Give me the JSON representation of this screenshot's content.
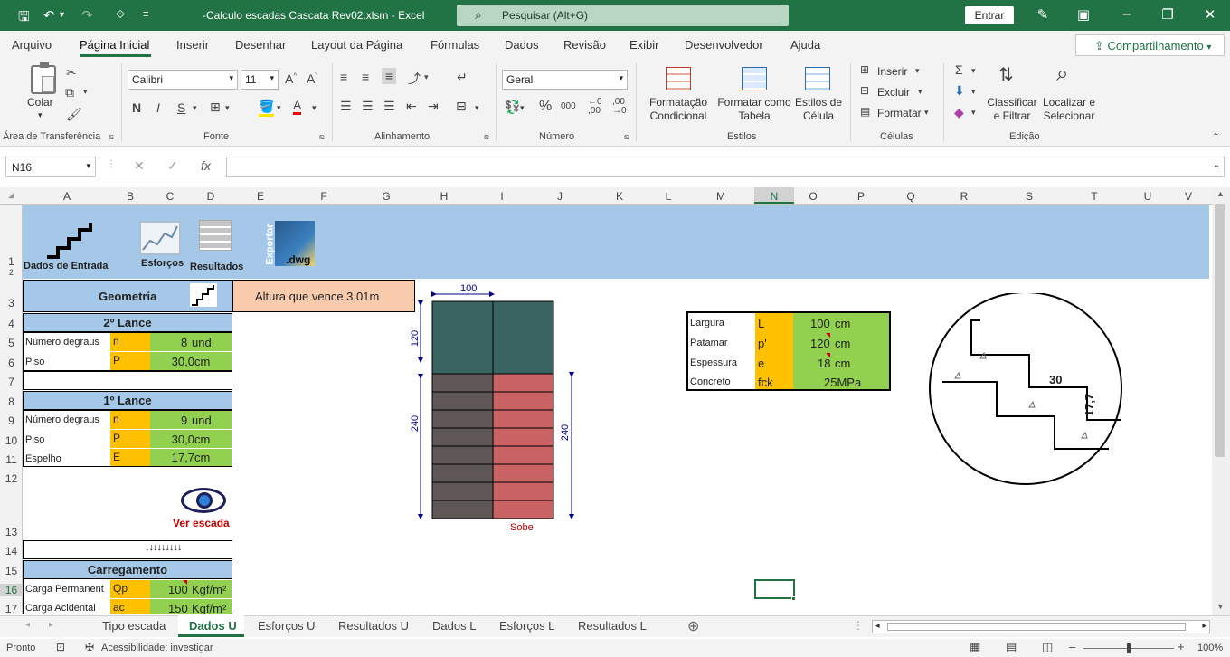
{
  "titlebar": {
    "save_icon": "save-icon",
    "title": "-Calculo escadas Cascata Rev02.xlsm  -  Excel",
    "search_placeholder": "Pesquisar (Alt+G)",
    "entrar": "Entrar"
  },
  "menu": {
    "tabs": [
      "Arquivo",
      "Página Inicial",
      "Inserir",
      "Desenhar",
      "Layout da Página",
      "Fórmulas",
      "Dados",
      "Revisão",
      "Exibir",
      "Desenvolvedor",
      "Ajuda"
    ],
    "share": "Compartilhamento"
  },
  "ribbon": {
    "clipboard": {
      "colar": "Colar",
      "label": "Área de Transferência"
    },
    "font": {
      "name": "Calibri",
      "size": "11",
      "bold": "N",
      "italic": "I",
      "underline": "S",
      "label": "Fonte"
    },
    "alignment": {
      "label": "Alinhamento"
    },
    "number": {
      "format": "Geral",
      "label": "Número"
    },
    "styles": {
      "cond_format": "Formatação Condicional",
      "table_format": "Formatar como Tabela",
      "cell_styles": "Estilos de Célula",
      "label": "Estilos"
    },
    "cells": {
      "insert": "Inserir",
      "delete": "Excluir",
      "format": "Formatar",
      "label": "Células"
    },
    "editing": {
      "sort": "Classificar e Filtrar",
      "find": "Localizar e Selecionar",
      "label": "Edição"
    }
  },
  "formula_bar": {
    "namebox": "N16",
    "fx": "fx",
    "value": ""
  },
  "columns": [
    "A",
    "B",
    "C",
    "D",
    "E",
    "F",
    "G",
    "H",
    "I",
    "J",
    "K",
    "L",
    "M",
    "N",
    "O",
    "P",
    "Q",
    "R",
    "S",
    "T",
    "U",
    "V"
  ],
  "rows": [
    "1",
    "2",
    "3",
    "4",
    "5",
    "6",
    "7",
    "8",
    "9",
    "10",
    "11",
    "12",
    "13",
    "14",
    "15",
    "16",
    "17"
  ],
  "header_buttons": {
    "dados": "Dados de Entrada",
    "esforcos": "Esforços",
    "resultados": "Resultados",
    "exportar": "Exportar",
    "dwg": ".dwg"
  },
  "sheet": {
    "geometria": "Geometria",
    "altura": "Altura que vence 3,01m",
    "lance2": "2º Lance",
    "lance1": "1º Lance",
    "n_degraus": "Número degraus",
    "piso": "Piso",
    "espelho": "Espelho",
    "l2": {
      "n_sym": "n",
      "n_val": "8",
      "n_unit": "und",
      "p_sym": "P",
      "p_val": "30,0cm"
    },
    "l1": {
      "n_sym": "n",
      "n_val": "9",
      "n_unit": "und",
      "p_sym": "P",
      "p_val": "30,0cm",
      "e_sym": "E",
      "e_val": "17,7cm"
    },
    "ver_escada": "Ver escada",
    "carregamento": "Carregamento",
    "carga_perm": "Carga Permanent",
    "carga_acid": "Carga Acidental",
    "qp_sym": "Qp",
    "qp_val": "100",
    "qp_unit": "Kgf/m²",
    "ac_sym": "ac",
    "ac_val": "150",
    "ac_unit": "Kgf/m²"
  },
  "drawing": {
    "dim_top": "100",
    "dim_left_top": "120",
    "dim_left": "240",
    "dim_right": "240",
    "sobe": "Sobe",
    "detail_30": "30",
    "detail_177": "17,7"
  },
  "props_table": [
    {
      "label": "Largura",
      "sym": "L",
      "val": "100",
      "unit": "cm"
    },
    {
      "label": "Patamar",
      "sym": "p'",
      "val": "120",
      "unit": "cm"
    },
    {
      "label": "Espessura",
      "sym": "e",
      "val": "18",
      "unit": "cm"
    },
    {
      "label": "Concreto",
      "sym": "fck",
      "val": "25MPa",
      "unit": ""
    }
  ],
  "sheet_tabs": [
    "Tipo escada",
    "Dados U",
    "Esforços U",
    "Resultados U",
    "Dados L",
    "Esforços L",
    "Resultados L"
  ],
  "status": {
    "ready": "Pronto",
    "access": "Acessibilidade: investigar",
    "zoom": "100%"
  }
}
